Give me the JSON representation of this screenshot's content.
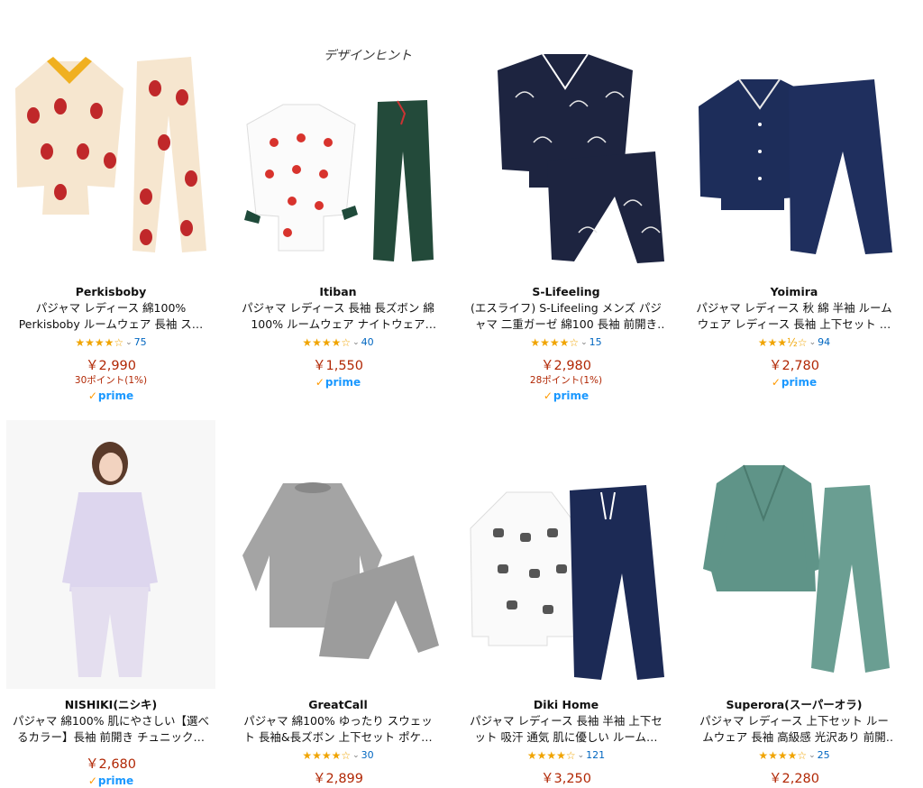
{
  "colors": {
    "price": "#b12704",
    "link": "#0066c0",
    "star": "#f0a400",
    "prime": "#1a98ff"
  },
  "products": [
    {
      "brand": "Perkisboby",
      "title": "パジャマ レディース 綿100% Perkisboby ルームウェア 長袖 ス…",
      "stars": "★★★★☆",
      "reviews": "75",
      "price": "￥2,990",
      "points": "30ポイント(1%)",
      "prime": "prime",
      "image": "pajama-cream-strawberry"
    },
    {
      "brand": "Itiban",
      "title": "パジャマ レディース 長袖 長ズボン 綿100% ルームウェア ナイトウェア 上…",
      "stars": "★★★★☆",
      "reviews": "40",
      "price": "￥1,550",
      "points": "",
      "prime": "prime",
      "image": "pajama-white-strawberry-green-pants",
      "image_text": "デザインヒント"
    },
    {
      "brand": "S-Lifeeling",
      "title": "(エスライフ) S-Lifeeling メンズ パジャマ 二重ガーゼ 綿100 長袖 前開き シ…",
      "stars": "★★★★☆",
      "reviews": "15",
      "price": "￥2,980",
      "points": "28ポイント(1%)",
      "prime": "prime",
      "image": "pajama-navy-feather"
    },
    {
      "brand": "Yoimira",
      "title": "パジャマ レディース 秋 綿 半袖 ルームウェア レディース 長袖 上下セット …",
      "stars": "★★★½☆",
      "reviews": "94",
      "price": "￥2,780",
      "points": "",
      "prime": "prime",
      "image": "pajama-navy-satin"
    },
    {
      "brand": "NISHIKI(ニシキ)",
      "title": "パジャマ 綿100% 肌にやさしい【選べるカラー】長袖 前開き チュニック丈 …",
      "stars": "",
      "reviews": "",
      "price": "￥2,680",
      "points": "",
      "prime": "prime",
      "image": "pajama-lavender-model"
    },
    {
      "brand": "GreatCall",
      "title": "パジャマ 綿100% ゆったり スウェット 長袖&長ズボン 上下セット ポケット…",
      "stars": "★★★★☆",
      "reviews": "30",
      "price": "￥2,899",
      "points": "",
      "prime": "",
      "image": "sweat-grey-set"
    },
    {
      "brand": "Diki Home",
      "title": "パジャマ レディース 長袖 半袖 上下セット 吸汗 通気 肌に優しい ルーム…",
      "stars": "★★★★☆",
      "reviews": "121",
      "price": "￥3,250",
      "points": "",
      "prime": "",
      "image": "pajama-dog-print-navy-pants"
    },
    {
      "brand": "Superora(スーパーオラ)",
      "title": "パジャマ レディース 上下セット ルームウェア 長袖 高級感 光沢あり 前開な…",
      "stars": "★★★★☆",
      "reviews": "25",
      "price": "￥2,280",
      "points": "",
      "prime": "",
      "image": "pajama-green-satin-lace"
    }
  ]
}
